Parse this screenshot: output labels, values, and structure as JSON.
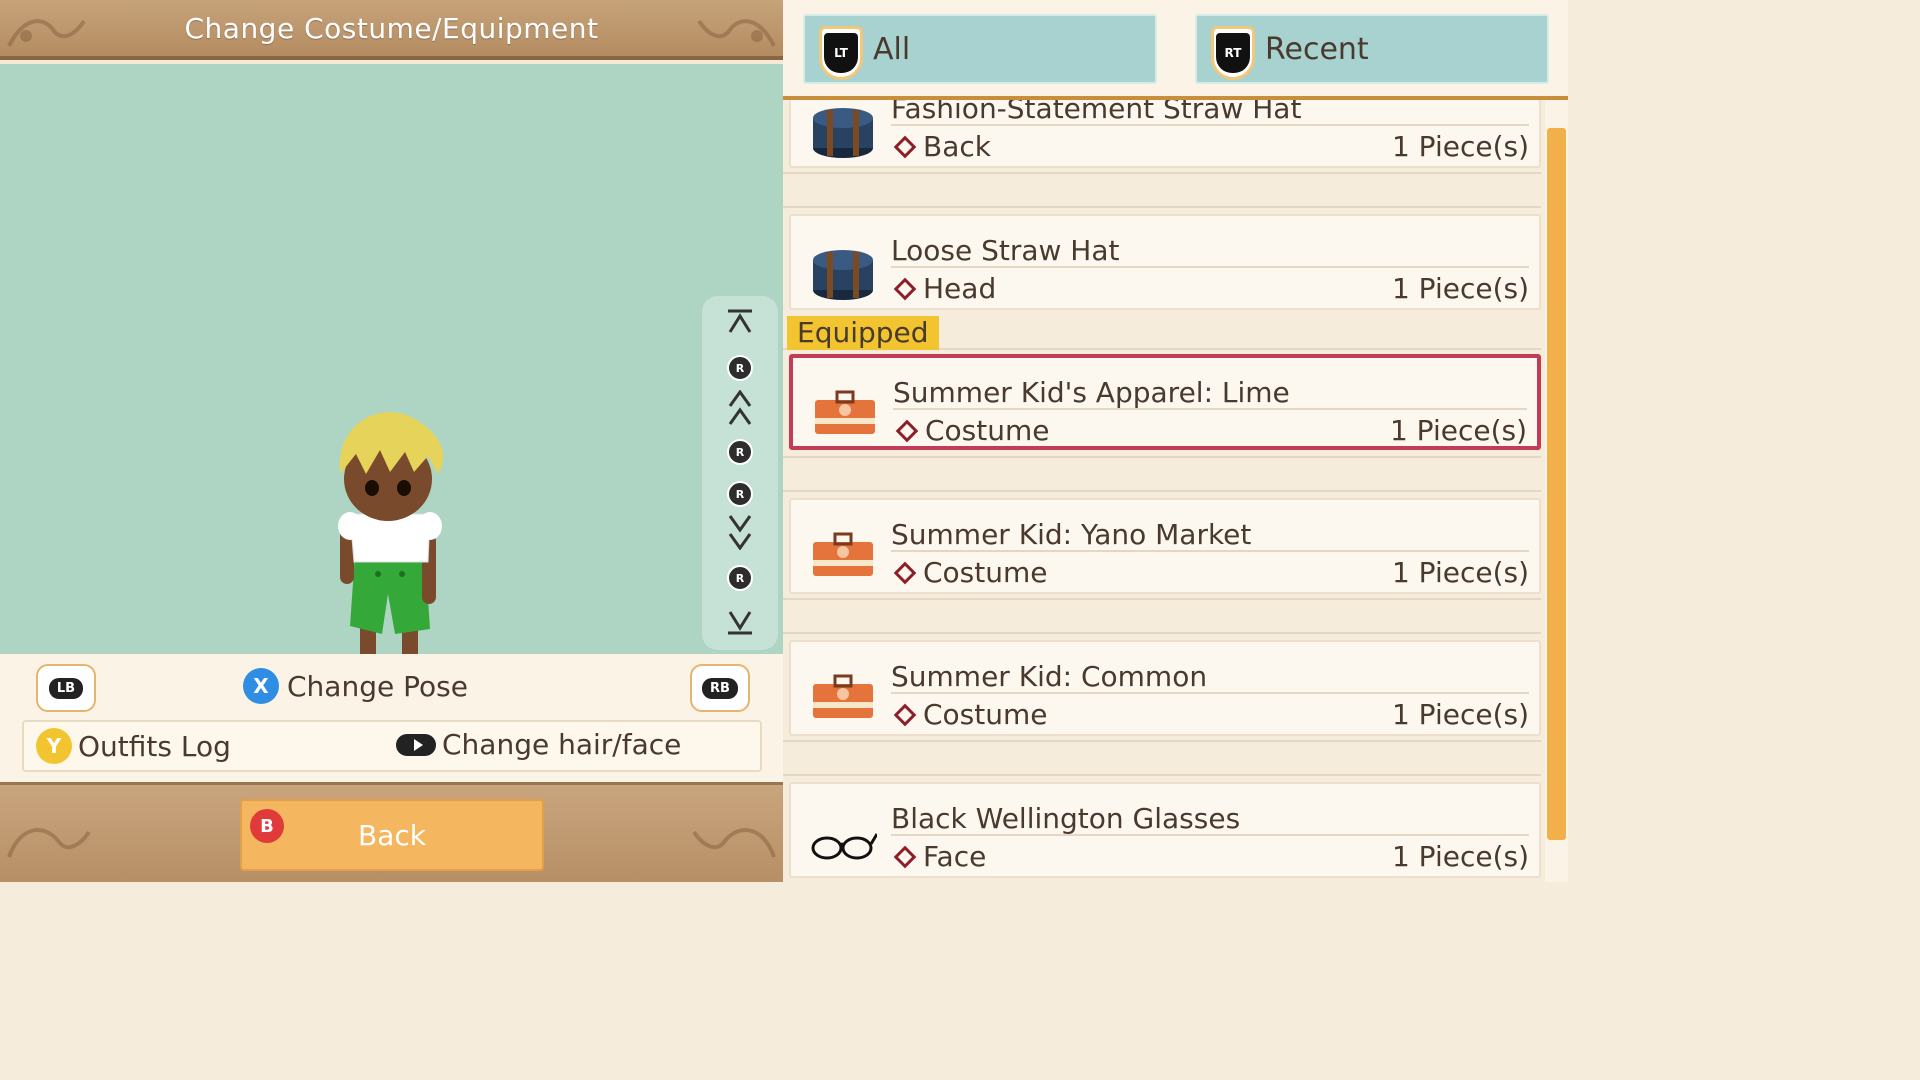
{
  "header": {
    "title": "Change Costume/Equipment"
  },
  "camera_controls": {
    "r_label": "R"
  },
  "controls": {
    "lb_label": "LB",
    "rb_label": "RB",
    "x_label": "X",
    "change_pose": "Change Pose",
    "y_label": "Y",
    "outfits_log": "Outfits Log",
    "change_hair_face": "Change hair/face"
  },
  "back": {
    "b_label": "B",
    "label": "Back"
  },
  "filters": {
    "lt_label": "LT",
    "all": "All",
    "rt_label": "RT",
    "recent": "Recent"
  },
  "equipped_tag": "Equipped",
  "items": [
    {
      "name": "Fashion-Statement Straw Hat",
      "slot": "Back",
      "qty": "1 Piece(s)",
      "icon": "hatbox-icon"
    },
    {
      "name": "Loose Straw Hat",
      "slot": "Head",
      "qty": "1 Piece(s)",
      "icon": "hatbox-icon"
    },
    {
      "name": "Summer Kid's Apparel: Lime",
      "slot": "Costume",
      "qty": "1 Piece(s)",
      "icon": "costume-case-icon",
      "equipped": true,
      "selected": true
    },
    {
      "name": "Summer Kid: Yano Market",
      "slot": "Costume",
      "qty": "1 Piece(s)",
      "icon": "costume-case-icon"
    },
    {
      "name": "Summer Kid: Common",
      "slot": "Costume",
      "qty": "1 Piece(s)",
      "icon": "costume-case-icon"
    },
    {
      "name": "Black Wellington Glasses",
      "slot": "Face",
      "qty": "1 Piece(s)",
      "icon": "glasses-icon"
    }
  ],
  "colors": {
    "preview_bg": "#aed5c4",
    "filter_tab": "#a8d2cf",
    "selected_border": "#c23b57",
    "equipped_tag": "#f2c530",
    "back_button": "#f4b65e",
    "x_button": "#2f8de4",
    "y_button": "#f2c530",
    "b_button": "#e03a3a"
  }
}
